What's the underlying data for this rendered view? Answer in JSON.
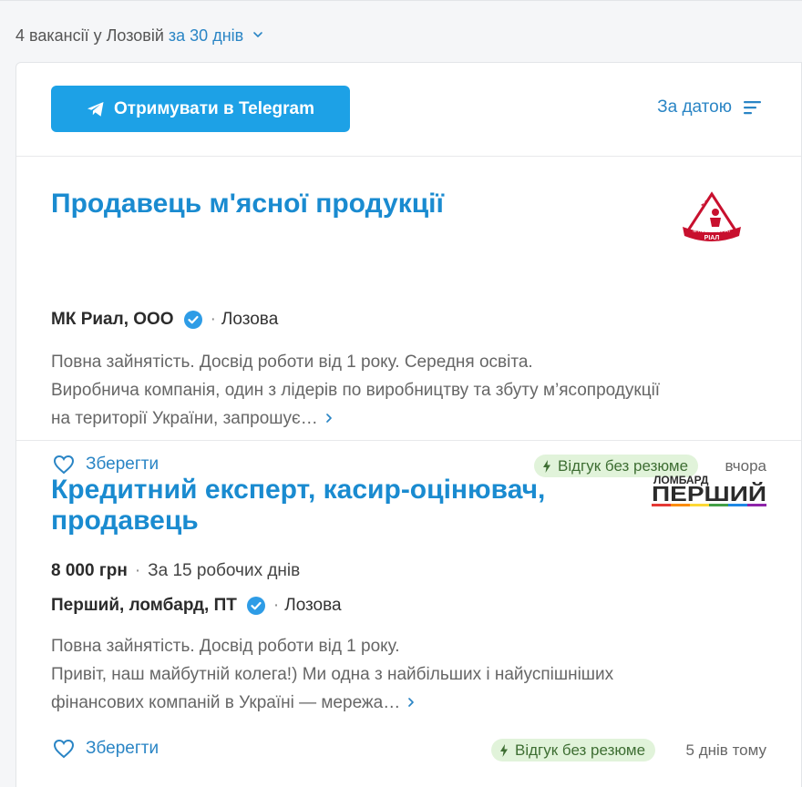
{
  "summary": {
    "count_text": "4 вакансії у Лозовій",
    "period": "за 30 днів"
  },
  "toolbar": {
    "telegram_label": "Отримувати в Telegram",
    "sort_label": "За датою"
  },
  "vacancies": [
    {
      "title": "Продавець м'ясної продукції",
      "company": "МК Риал, ООО",
      "city": "Лозова",
      "logo_text_top": "М'ЯСОКОМБІНАТ",
      "logo_text_bottom": "РІАЛ",
      "desc_line1": "Повна зайнятість. Досвід роботи від 1 року. Середня освіта.",
      "desc_line2": "Виробнича компанія, один з лідерів по виробництву та збуту м’ясопродукції",
      "desc_line3": "на території України, запрошує…",
      "save_label": "Зберегти",
      "badge": "Відгук без резюме",
      "time": "вчора"
    },
    {
      "title_line1": "Кредитний експерт, касир-оцінювач,",
      "title_line2": "продавець",
      "salary": "8 000 грн",
      "pay_period": "За 15 робочих днів",
      "company": "Перший, ломбард, ПТ",
      "city": "Лозова",
      "logo_text_top": "ЛОМБАРД",
      "logo_text_bottom": "ПЕРШИЙ",
      "desc_line1": "Повна зайнятість. Досвід роботи від 1 року.",
      "desc_line2": "Привіт, наш майбутній колега!) Ми одна з найбільших і найуспішніших",
      "desc_line3": "фінансових компаній в Україні — мережа…",
      "save_label": "Зберегти",
      "badge": "Відгук без резюме",
      "time": "5 днів тому"
    }
  ],
  "colors": {
    "accent": "#1a8bd0",
    "telegram_button": "#1da1e6",
    "verified": "#2e9ce6",
    "badge_bg": "#e1f3da",
    "rial_logo": "#c8102e"
  },
  "icons": {
    "telegram": "telegram-icon",
    "sort": "sort-lines-icon",
    "verified": "verified-check-icon",
    "heart": "heart-outline-icon",
    "lightning": "lightning-icon",
    "chevron": "chevron-right-icon"
  }
}
